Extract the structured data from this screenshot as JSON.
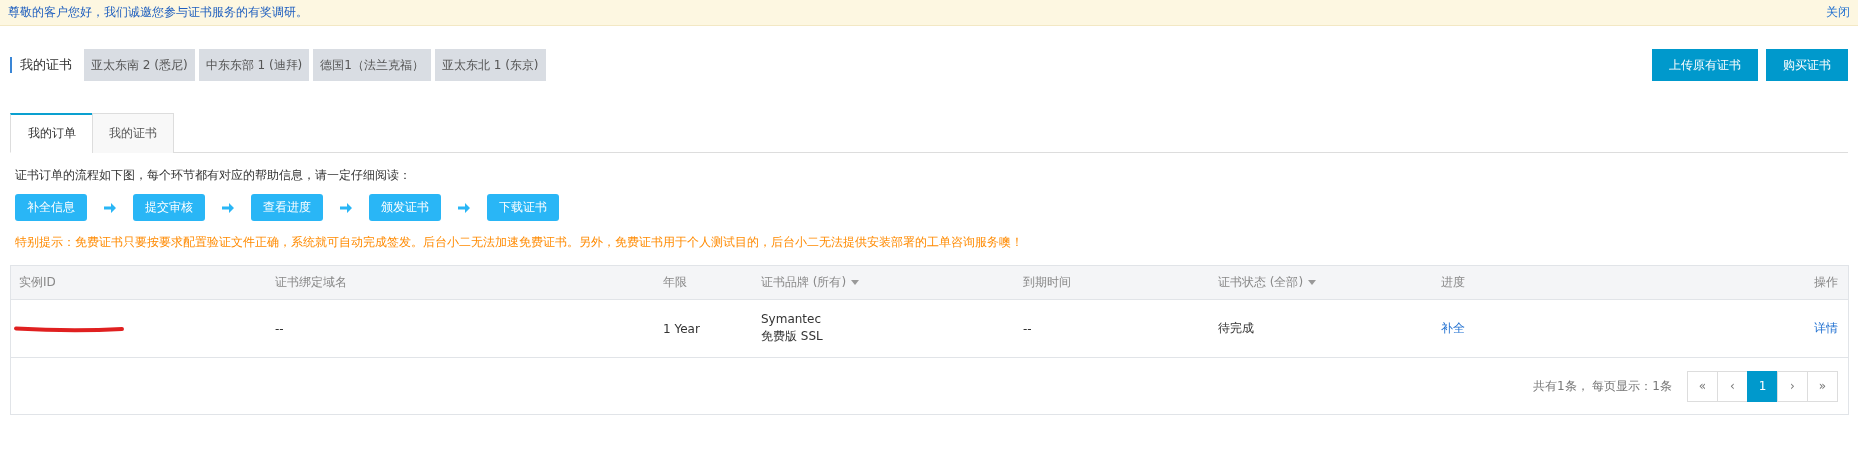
{
  "banner": {
    "message": "尊敬的客户您好，我们诚邀您参与证书服务的有奖调研。",
    "close": "关闭"
  },
  "header": {
    "title": "我的证书",
    "regions": [
      "亚太东南 2 (悉尼)",
      "中东东部 1 (迪拜)",
      "德国1（法兰克福）",
      "亚太东北 1 (东京)"
    ],
    "buttons": [
      "上传原有证书",
      "购买证书"
    ]
  },
  "tabs": [
    {
      "label": "我的订单",
      "selected": true
    },
    {
      "label": "我的证书",
      "selected": false
    }
  ],
  "flow": {
    "intro": "证书订单的流程如下图，每个环节都有对应的帮助信息，请一定仔细阅读：",
    "steps": [
      "补全信息",
      "提交审核",
      "查看进度",
      "颁发证书",
      "下载证书"
    ],
    "tip": "特别提示：免费证书只要按要求配置验证文件正确，系统就可自动完成签发。后台小二无法加速免费证书。另外，免费证书用于个人测试目的，后台小二无法提供安装部署的工单咨询服务噢！"
  },
  "table": {
    "columns": [
      {
        "label": "实例ID",
        "dropdown": false
      },
      {
        "label": "证书绑定域名",
        "dropdown": false
      },
      {
        "label": "年限",
        "dropdown": false
      },
      {
        "label": "证书品牌 (所有)",
        "dropdown": true
      },
      {
        "label": "到期时间",
        "dropdown": false
      },
      {
        "label": "证书状态 (全部)",
        "dropdown": true
      },
      {
        "label": "进度",
        "dropdown": false
      },
      {
        "label": "操作",
        "dropdown": false
      }
    ],
    "rows": [
      {
        "cells": [
          {
            "kind": "redacted"
          },
          {
            "kind": "text",
            "lines": [
              "--"
            ]
          },
          {
            "kind": "text",
            "lines": [
              "1 Year"
            ]
          },
          {
            "kind": "text",
            "lines": [
              "Symantec",
              "免费版 SSL"
            ]
          },
          {
            "kind": "text",
            "lines": [
              "--"
            ]
          },
          {
            "kind": "text",
            "lines": [
              "待完成"
            ]
          },
          {
            "kind": "link",
            "lines": [
              "补全"
            ]
          },
          {
            "kind": "link",
            "lines": [
              "详情"
            ]
          }
        ]
      }
    ]
  },
  "pagination": {
    "summary": "共有1条， 每页显示：1条",
    "pages": [
      {
        "label": "«",
        "selected": false
      },
      {
        "label": "‹",
        "selected": false
      },
      {
        "label": "1",
        "selected": true
      },
      {
        "label": "›",
        "selected": false
      },
      {
        "label": "»",
        "selected": false
      }
    ]
  }
}
